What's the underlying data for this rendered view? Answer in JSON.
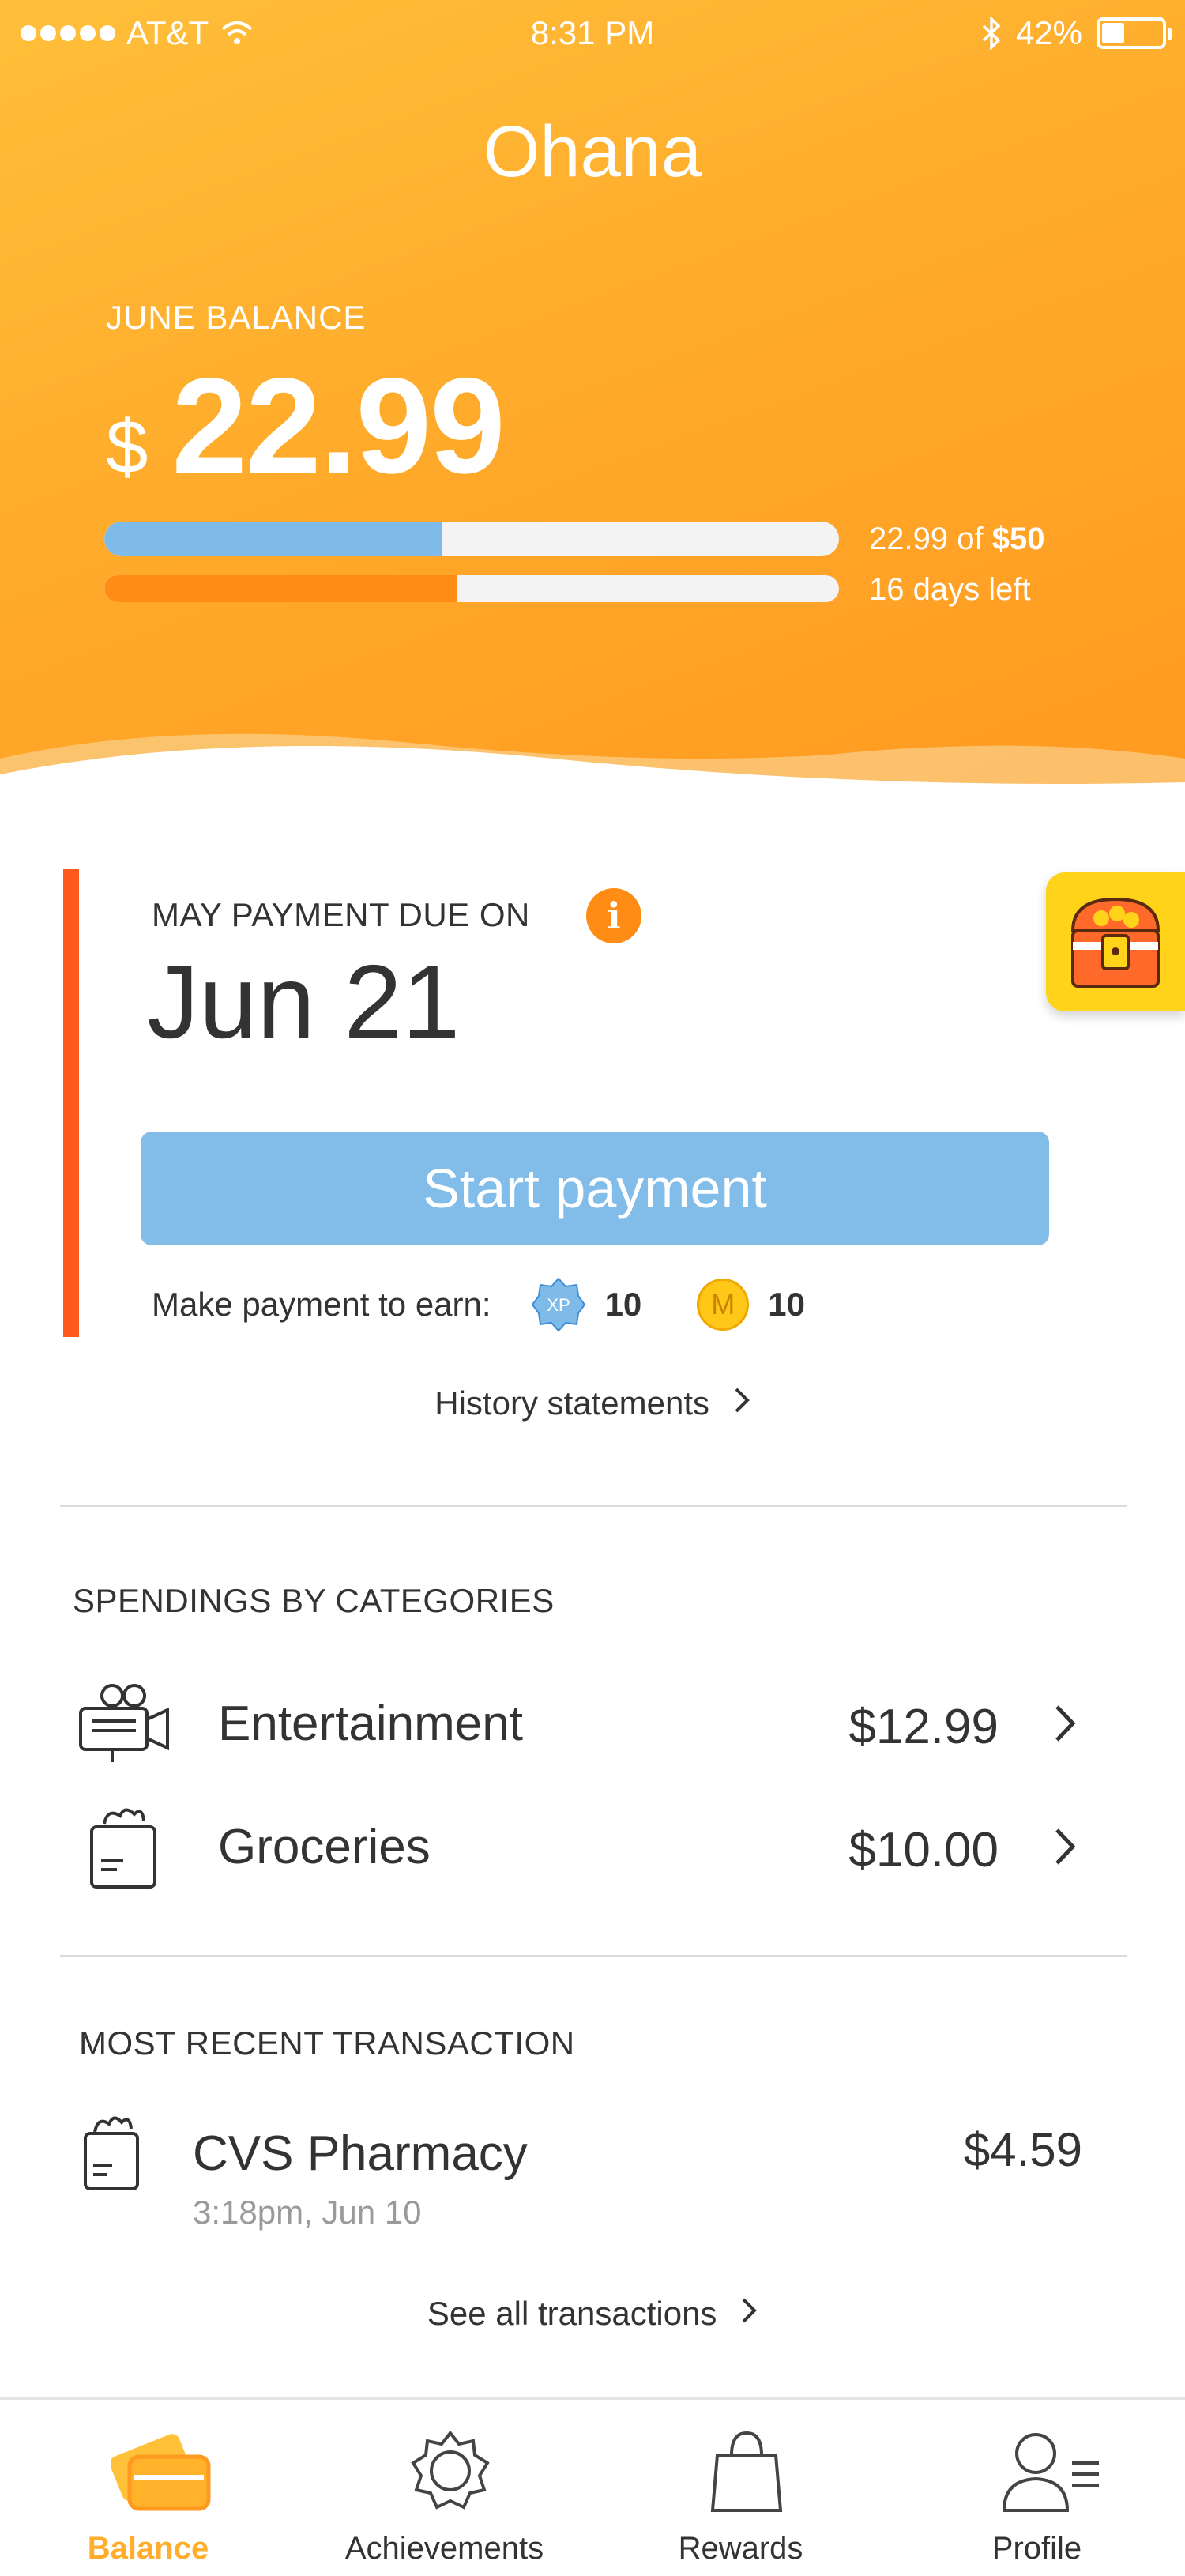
{
  "status_bar": {
    "carrier": "AT&T",
    "time": "8:31 PM",
    "battery": "42%",
    "battery_level": 0.42
  },
  "header": {
    "title": "Ohana",
    "balance_label": "JUNE BALANCE",
    "currency_symbol": "$",
    "balance_amount": "22.99",
    "progress_caption_prefix": "22.99 of",
    "progress_caption_limit": "$50",
    "spend_progress": 0.46,
    "days_caption": "16 days left",
    "days_progress": 0.48
  },
  "payment": {
    "due_label": "MAY PAYMENT DUE ON",
    "info_icon": "i",
    "due_date": "Jun 21",
    "button_label": "Start payment",
    "earn_label": "Make payment to earn:",
    "xp_badge": "XP",
    "xp_value": "10",
    "coin_badge": "M",
    "coin_value": "10",
    "history_link": "History statements"
  },
  "categories": {
    "title": "SPENDINGS BY CATEGORIES",
    "items": [
      {
        "name": "Entertainment",
        "amount": "$12.99",
        "icon": "camera-icon"
      },
      {
        "name": "Groceries",
        "amount": "$10.00",
        "icon": "grocery-bag-icon"
      }
    ]
  },
  "recent": {
    "title": "MOST RECENT TRANSACTION",
    "merchant": "CVS Pharmacy",
    "time": "3:18pm, Jun 10",
    "amount": "$4.59",
    "see_all": "See all transactions"
  },
  "tabs": [
    {
      "label": "Balance",
      "icon": "card-icon",
      "active": true
    },
    {
      "label": "Achievements",
      "icon": "badge-icon",
      "active": false
    },
    {
      "label": "Rewards",
      "icon": "bag-icon",
      "active": false
    },
    {
      "label": "Profile",
      "icon": "profile-icon",
      "active": false
    }
  ],
  "colors": {
    "header_orange": "#ffa92a",
    "accent_blue": "#82bce9",
    "accent_orange": "#ff8c14",
    "due_red": "#ff5a1e",
    "chest_yellow": "#ffd31a"
  }
}
